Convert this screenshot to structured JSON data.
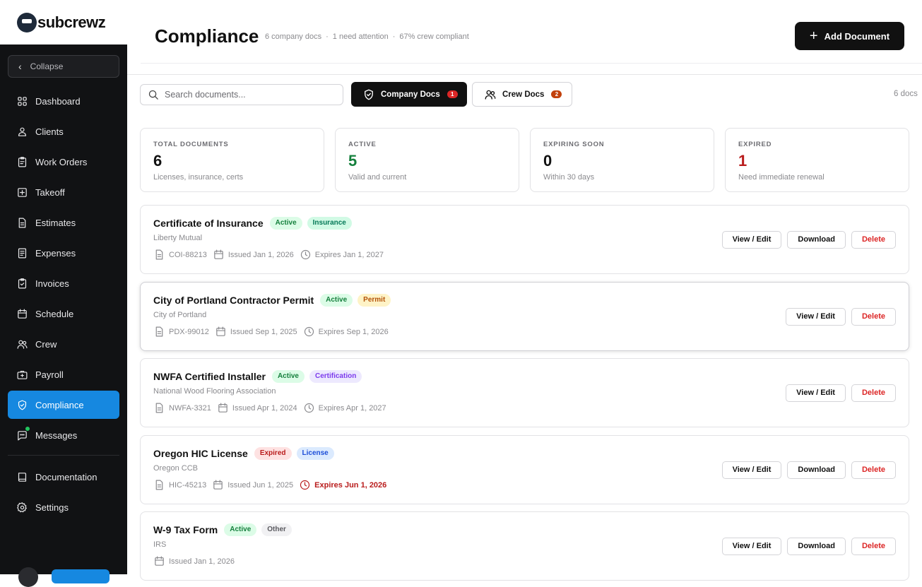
{
  "brand": {
    "logo_text": "subcrewz"
  },
  "sidebar": {
    "collapse_label": "Collapse",
    "items": [
      {
        "label": "Dashboard",
        "icon": "grid-icon"
      },
      {
        "label": "Clients",
        "icon": "users-icon"
      },
      {
        "label": "Work Orders",
        "icon": "clipboard-icon"
      },
      {
        "label": "Takeoff",
        "icon": "plus-square-icon"
      },
      {
        "label": "Estimates",
        "icon": "file-icon"
      },
      {
        "label": "Expenses",
        "icon": "receipt-icon"
      },
      {
        "label": "Invoices",
        "icon": "clipboard-check-icon"
      },
      {
        "label": "Schedule",
        "icon": "calendar-icon"
      },
      {
        "label": "Crew",
        "icon": "crew-icon"
      },
      {
        "label": "Payroll",
        "icon": "briefcase-plus-icon"
      },
      {
        "label": "Compliance",
        "icon": "shield-check-icon",
        "active": true
      },
      {
        "label": "Messages",
        "icon": "message-icon"
      }
    ],
    "footer_items": [
      {
        "label": "Documentation",
        "icon": "book-icon"
      },
      {
        "label": "Settings",
        "icon": "gear-icon"
      }
    ]
  },
  "header": {
    "title": "Compliance",
    "meta": [
      "6 company docs",
      "·",
      "1 need attention",
      "·",
      "67% crew compliant"
    ],
    "add_button": "Add Document"
  },
  "toolbar": {
    "search_placeholder": "Search documents...",
    "tabs": [
      {
        "label": "Company Docs",
        "badge": "1",
        "icon": "shield-check-icon"
      },
      {
        "label": "Crew Docs",
        "badge": "2",
        "icon": "crew-icon"
      }
    ],
    "doc_count": "6 docs"
  },
  "stats": [
    {
      "label": "TOTAL DOCUMENTS",
      "value": "6",
      "sub": "Licenses, insurance, certs",
      "color": "#111111"
    },
    {
      "label": "ACTIVE",
      "value": "5",
      "sub": "Valid and current",
      "color": "#15803d"
    },
    {
      "label": "EXPIRING SOON",
      "value": "0",
      "sub": "Within 30 days",
      "color": "#111111"
    },
    {
      "label": "EXPIRED",
      "value": "1",
      "sub": "Need immediate renewal",
      "color": "#b91c1c"
    }
  ],
  "documents": [
    {
      "title": "Certificate of Insurance",
      "status": "Active",
      "category": "Insurance",
      "issuer": "Liberty Mutual",
      "number": "COI-88213",
      "issued": "Issued Jan 1, 2026",
      "expires": "Expires Jan 1, 2027",
      "expired": false,
      "actions": [
        "View / Edit",
        "Download",
        "Delete"
      ]
    },
    {
      "title": "City of Portland Contractor Permit",
      "status": "Active",
      "category": "Permit",
      "issuer": "City of Portland",
      "number": "PDX-99012",
      "issued": "Issued Sep 1, 2025",
      "expires": "Expires Sep 1, 2026",
      "expired": false,
      "actions": [
        "View / Edit",
        "Delete"
      ]
    },
    {
      "title": "NWFA Certified Installer",
      "status": "Active",
      "category": "Certification",
      "issuer": "National Wood Flooring Association",
      "number": "NWFA-3321",
      "issued": "Issued Apr 1, 2024",
      "expires": "Expires Apr 1, 2027",
      "expired": false,
      "actions": [
        "View / Edit",
        "Delete"
      ]
    },
    {
      "title": "Oregon HIC License",
      "status": "Expired",
      "category": "License",
      "issuer": "Oregon CCB",
      "number": "HIC-45213",
      "issued": "Issued Jun 1, 2025",
      "expires": "Expires Jun 1, 2026",
      "expired": true,
      "actions": [
        "View / Edit",
        "Download",
        "Delete"
      ]
    },
    {
      "title": "W-9 Tax Form",
      "status": "Active",
      "category": "Other",
      "issuer": "IRS",
      "number": "",
      "issued": "Issued Jan 1, 2026",
      "expires": "",
      "expired": false,
      "actions": [
        "View / Edit",
        "Download",
        "Delete"
      ]
    }
  ]
}
